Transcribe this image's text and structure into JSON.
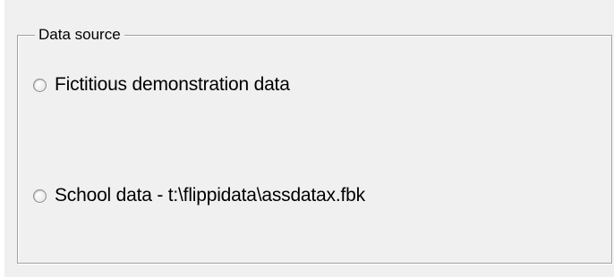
{
  "groupbox": {
    "title": "Data source",
    "options": [
      {
        "label": "Fictitious demonstration data",
        "selected": false
      },
      {
        "label": "School data  - t:\\flippidata\\assdatax.fbk",
        "selected": false
      }
    ]
  }
}
